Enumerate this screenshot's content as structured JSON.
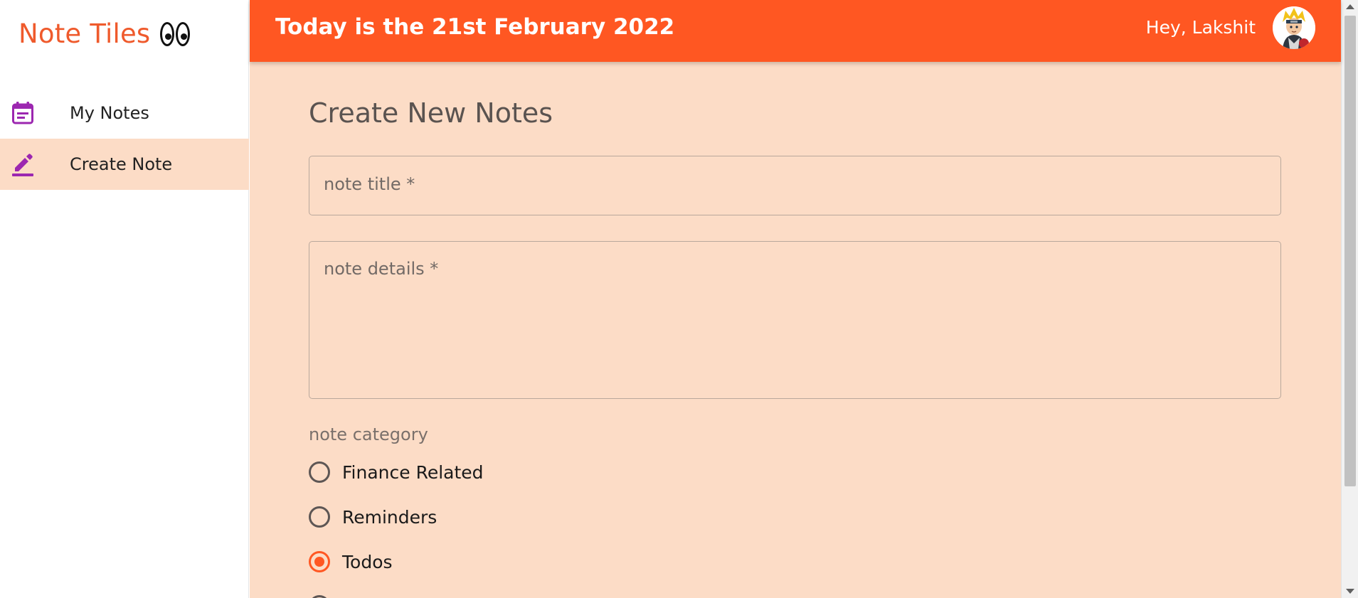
{
  "brand": {
    "name": "Note Tiles",
    "emoji_icon": "eyes-icon"
  },
  "sidebar": {
    "items": [
      {
        "label": "My Notes",
        "icon": "notes-calendar-icon",
        "active": false
      },
      {
        "label": "Create Note",
        "icon": "pencil-icon",
        "active": true
      }
    ]
  },
  "header": {
    "date_text": "Today is the 21st February 2022",
    "greeting": "Hey, Lakshit",
    "avatar": "user-avatar"
  },
  "form": {
    "title": "Create New Notes",
    "title_field": {
      "placeholder": "note title *",
      "value": ""
    },
    "details_field": {
      "placeholder": "note details *",
      "value": ""
    },
    "category_label": "note category",
    "categories": [
      {
        "label": "Finance Related",
        "selected": false
      },
      {
        "label": "Reminders",
        "selected": false
      },
      {
        "label": "Todos",
        "selected": true
      },
      {
        "label": "",
        "selected": false
      }
    ]
  },
  "colors": {
    "accent": "#ff5722",
    "brand_text": "#ef5a2c",
    "main_bg": "#fcdcc6",
    "icon_purple": "#9c27b0"
  }
}
